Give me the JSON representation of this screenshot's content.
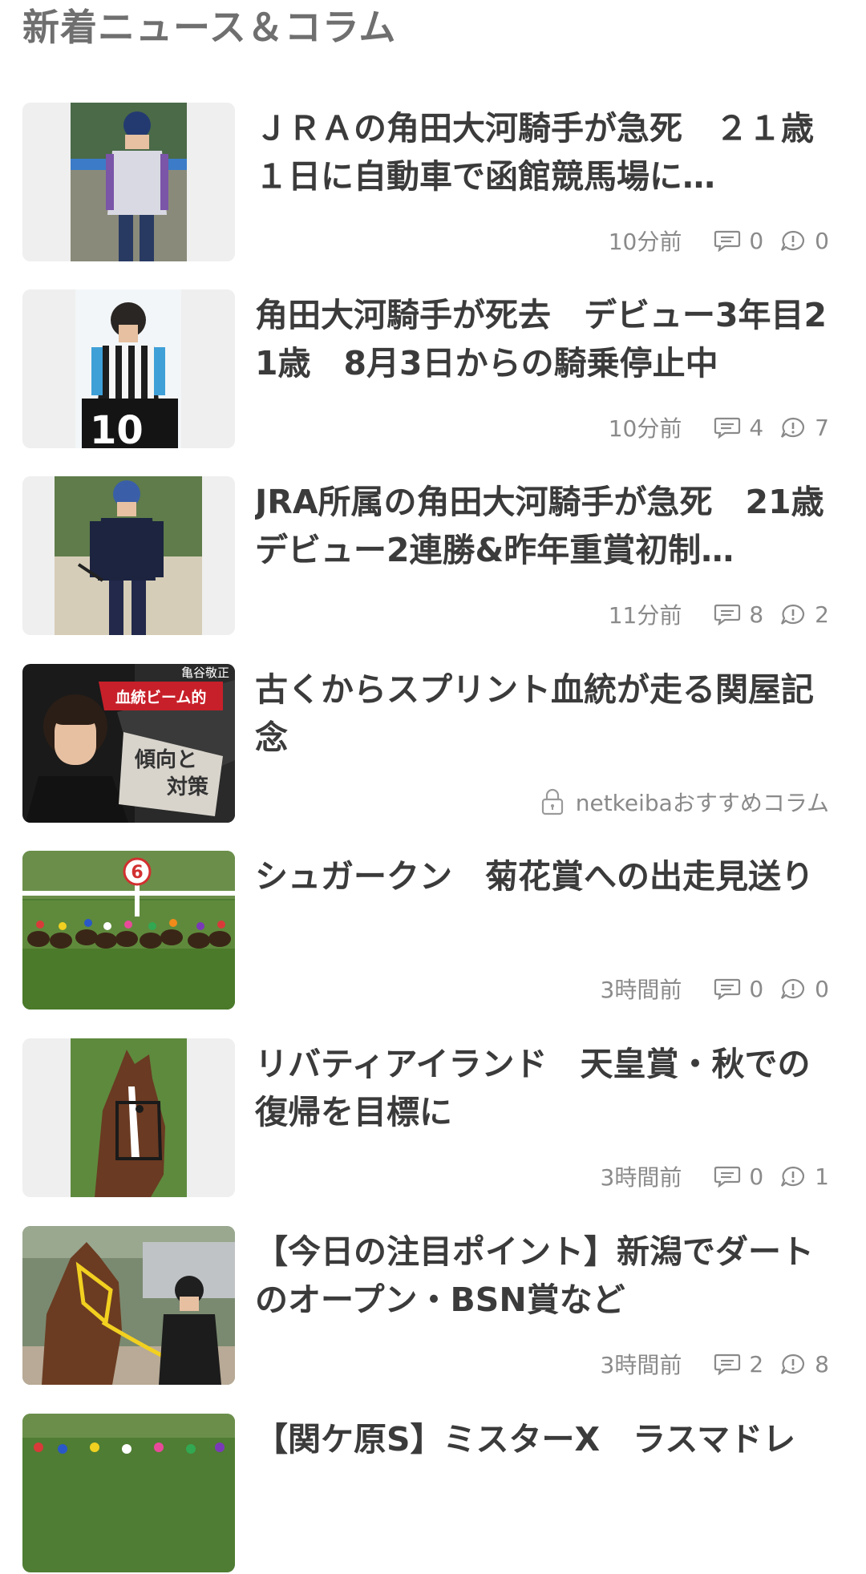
{
  "section": {
    "title": "新着ニュース＆コラム"
  },
  "items": [
    {
      "headline": "ＪＲＡの角田大河騎手が急死　２１歳　１日に自動車で函館競馬場に…",
      "time": "10分前",
      "comments": "0",
      "reports": "0"
    },
    {
      "headline": "角田大河騎手が死去　デビュー3年目21歳　8月3日からの騎乗停止中",
      "time": "10分前",
      "comments": "4",
      "reports": "7"
    },
    {
      "headline": "JRA所属の角田大河騎手が急死　21歳　デビュー2連勝&昨年重賞初制…",
      "time": "11分前",
      "comments": "8",
      "reports": "2"
    },
    {
      "headline": "古くからスプリント血統が走る関屋記念",
      "source": "netkeibaおすすめコラム",
      "thumb_text": {
        "author": "亀谷敬正",
        "series": "血統ビーム的",
        "topic_line1": "傾向と",
        "topic_line2": "対策"
      }
    },
    {
      "headline": "シュガークン　菊花賞への出走見送り",
      "time": "3時間前",
      "comments": "0",
      "reports": "0",
      "thumb_text": {
        "pole_number": "6"
      }
    },
    {
      "headline": "リバティアイランド　天皇賞・秋での復帰を目標に",
      "time": "3時間前",
      "comments": "0",
      "reports": "1"
    },
    {
      "headline": "【今日の注目ポイント】新潟でダートのオープン・BSN賞など",
      "time": "3時間前",
      "comments": "2",
      "reports": "8"
    },
    {
      "headline": "【関ケ原S】ミスターX　ラスマドレ"
    }
  ],
  "thumb_text_item2": {
    "bib": "10"
  },
  "colors": {
    "title": "#6f6f6f",
    "headline": "#3b3b3b",
    "meta": "#8a8a8a",
    "thumb_bg": "#efefef",
    "column_red": "#c8202a"
  }
}
